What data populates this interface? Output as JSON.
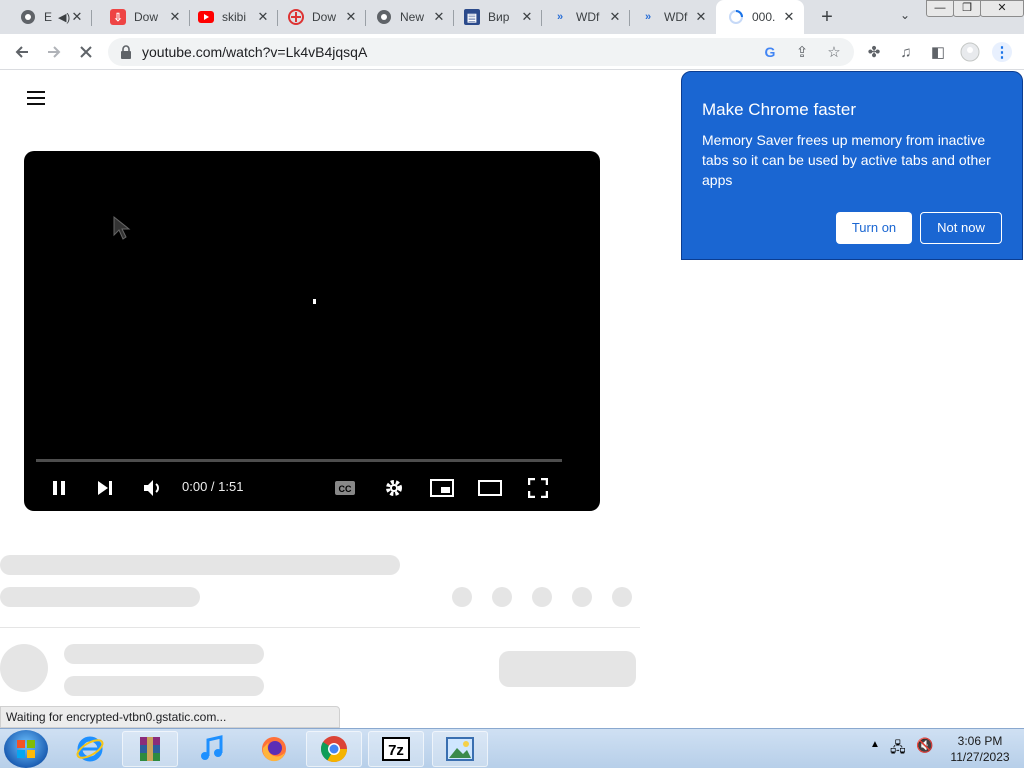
{
  "tabs": [
    {
      "title": "E",
      "icon": "chrome-icon",
      "left": 0
    },
    {
      "title": "Dow",
      "icon": "download-icon"
    },
    {
      "title": "skibi",
      "icon": "youtube-icon"
    },
    {
      "title": "Dow",
      "icon": "download-icon"
    },
    {
      "title": "New",
      "icon": "chrome-icon"
    },
    {
      "title": "Вир",
      "icon": "site-icon"
    },
    {
      "title": "WDf",
      "icon": "chevron-icon"
    },
    {
      "title": "WDf",
      "icon": "chevron-icon"
    },
    {
      "title": "000.",
      "icon": "loading-icon"
    }
  ],
  "address": {
    "url": "youtube.com/watch?v=Lk4vB4jqsqA"
  },
  "player": {
    "time": "0:00 / 1:51"
  },
  "popup": {
    "title": "Make Chrome faster",
    "body": "Memory Saver frees up memory from inactive tabs so it can be used by active tabs and other apps",
    "turn_on": "Turn on",
    "not_now": "Not now"
  },
  "status": {
    "text": "Waiting for encrypted-vtbn0.gstatic.com..."
  },
  "clock": {
    "time": "3:06 PM",
    "date": "11/27/2023"
  },
  "colors": {
    "popup_bg": "#1a66d2",
    "youtube_red": "#ff0000"
  }
}
